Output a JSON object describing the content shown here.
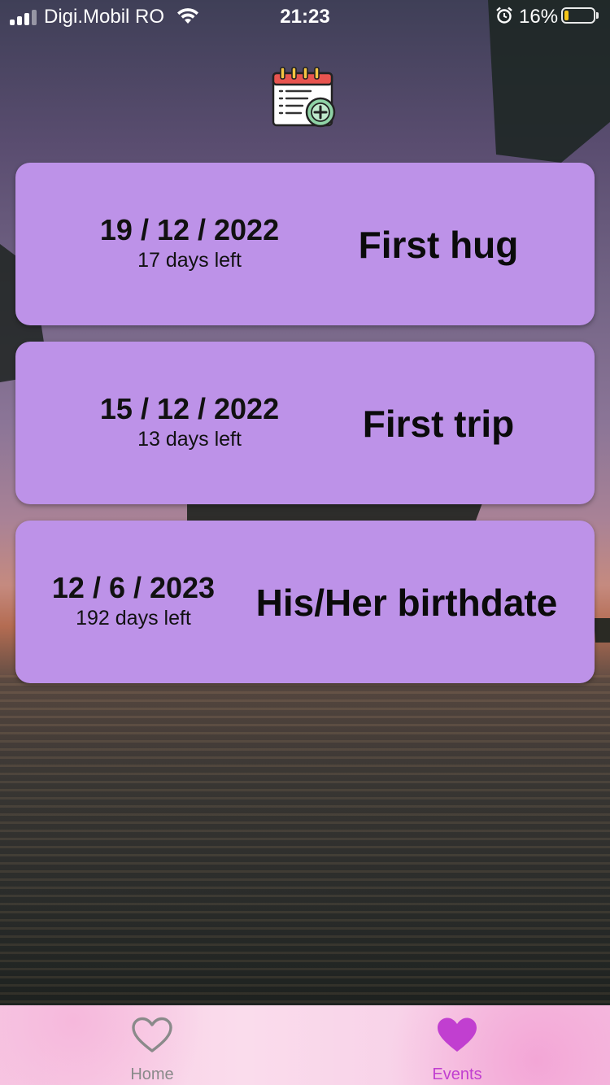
{
  "status_bar": {
    "carrier": "Digi.Mobil RO",
    "time": "21:23",
    "battery_percent": "16%",
    "battery_level": 0.16,
    "battery_color": "#f5c518",
    "icons": [
      "signal-icon",
      "wifi-icon",
      "alarm-icon",
      "battery-icon"
    ]
  },
  "header": {
    "add_event_icon": "calendar-add-icon"
  },
  "events": [
    {
      "date": "19 / 12 / 2022",
      "days_left": "17 days left",
      "name": "First hug"
    },
    {
      "date": "15 / 12 / 2022",
      "days_left": "13 days left",
      "name": "First trip"
    },
    {
      "date": "12 / 6 / 2023",
      "days_left": "192 days left",
      "name": "His/Her birthdate"
    }
  ],
  "tab_bar": {
    "tabs": [
      {
        "label": "Home",
        "icon": "heart-outline-icon",
        "active": false,
        "color": "#8a8a8a"
      },
      {
        "label": "Events",
        "icon": "heart-filled-icon",
        "active": true,
        "color": "#c13fd0"
      }
    ]
  },
  "colors": {
    "card_background": "#bd92e8",
    "tab_active": "#c13fd0",
    "tab_inactive": "#8a8a8a"
  }
}
